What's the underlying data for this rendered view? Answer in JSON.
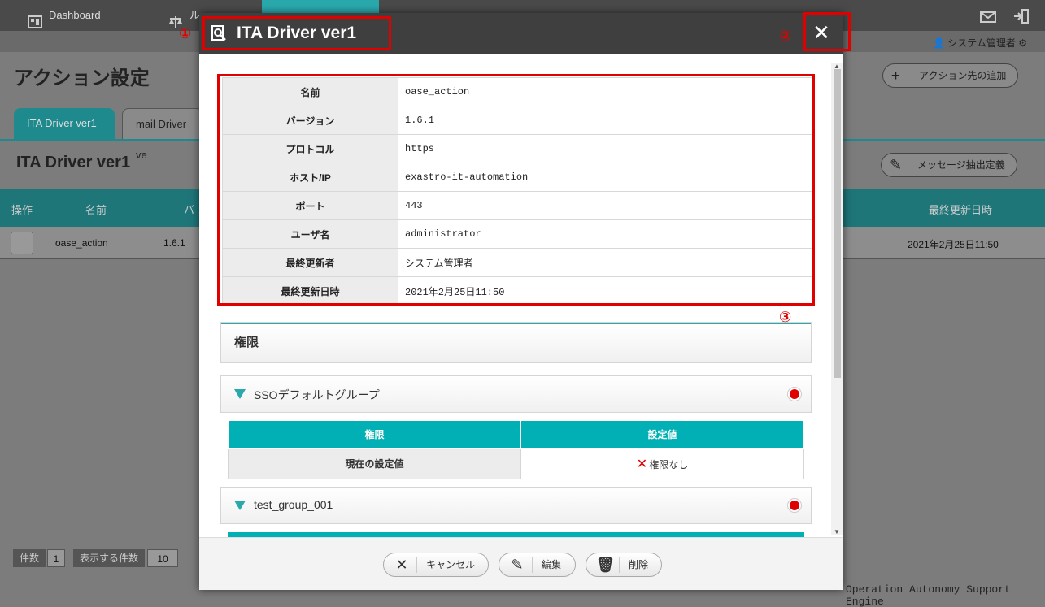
{
  "nav": {
    "dashboard": "Dashboard",
    "item2": "ル",
    "item3": "",
    "item4": "",
    "user": "システム管理者"
  },
  "page": {
    "title": "アクション設定",
    "add_button": "アクション先の追加",
    "tabs": [
      "ITA Driver ver1",
      "mail Driver ve"
    ],
    "section_title": "ITA Driver ver1",
    "extract_button": "メッセージ抽出定義",
    "table": {
      "headers": [
        "操作",
        "名前",
        "バ",
        "最終更新日時"
      ],
      "row": {
        "name": "oase_action",
        "version": "1.6.1",
        "updated": "2021年2月25日11:50"
      }
    },
    "footer": {
      "count_label": "件数",
      "count_value": "1",
      "per_page_label": "表示する件数",
      "per_page_value": "10"
    },
    "bottom_text": "Operation Autonomy Support Engine"
  },
  "modal": {
    "title": "ITA Driver ver1",
    "close": "✕",
    "annotations": [
      "①",
      "②",
      "③"
    ],
    "details": [
      {
        "key": "名前",
        "value": "oase_action"
      },
      {
        "key": "バージョン",
        "value": "1.6.1"
      },
      {
        "key": "プロトコル",
        "value": "https"
      },
      {
        "key": "ホスト/IP",
        "value": "exastro-it-automation"
      },
      {
        "key": "ポート",
        "value": "443"
      },
      {
        "key": "ユーザ名",
        "value": "administrator"
      },
      {
        "key": "最終更新者",
        "value": "システム管理者"
      },
      {
        "key": "最終更新日時",
        "value": "2021年2月25日11:50"
      }
    ],
    "permission_title": "権限",
    "groups": [
      {
        "name": "SSOデフォルトグループ",
        "col1": "権限",
        "col2": "設定値",
        "row_label": "現在の設定値",
        "row_value": "権限なし"
      },
      {
        "name": "test_group_001"
      }
    ],
    "buttons": {
      "cancel": "キャンセル",
      "edit": "編集",
      "delete": "削除"
    }
  },
  "colors": {
    "accent": "#00b0b4",
    "annotation": "#e00000",
    "header": "#3f3f3f"
  }
}
